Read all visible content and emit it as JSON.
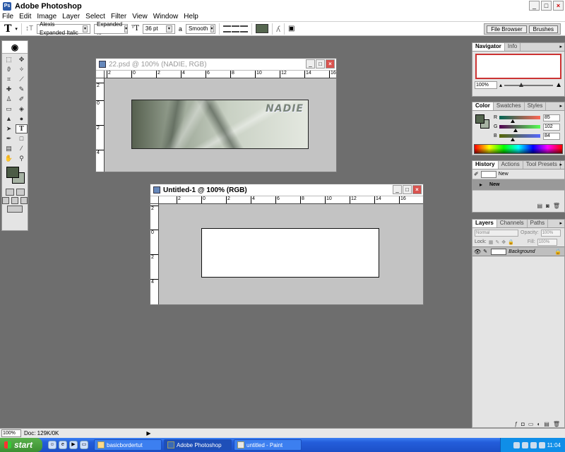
{
  "app": {
    "title": "Adobe Photoshop",
    "logo": "Ps"
  },
  "window_controls": {
    "minimize": "_",
    "maximize": "□",
    "close": "×"
  },
  "menu": [
    "File",
    "Edit",
    "Image",
    "Layer",
    "Select",
    "Filter",
    "View",
    "Window",
    "Help"
  ],
  "options": {
    "tool_glyph": "T",
    "font_family": "Alexis Expanded Italic",
    "font_style": "Expanded ...",
    "font_size": "36 pt",
    "aa_label": "a",
    "antialias": "Smooth",
    "text_color": "#55664f"
  },
  "palette_well": {
    "tabs": [
      "File Browser",
      "Brushes"
    ]
  },
  "toolbox": {
    "colors": {
      "foreground": "#4c5c46",
      "background": "#a6b2a3"
    }
  },
  "documents": {
    "doc1": {
      "title": "22.psd @ 100% (NADIE, RGB)",
      "ruler_h": [
        "2",
        "0",
        "2",
        "4",
        "6",
        "8",
        "10",
        "12",
        "14",
        "16"
      ],
      "ruler_v": [
        "2",
        "0",
        "2",
        "4"
      ],
      "wordmark": "NADIE"
    },
    "doc2": {
      "title": "Untitled-1 @ 100% (RGB)",
      "ruler_h": [
        "2",
        "0",
        "2",
        "4",
        "6",
        "8",
        "10",
        "12",
        "14",
        "16"
      ],
      "ruler_v": [
        "2",
        "0",
        "2",
        "4"
      ]
    }
  },
  "navigator": {
    "tabs": [
      "Navigator",
      "Info"
    ],
    "zoom": "100%"
  },
  "color_palette": {
    "tabs": [
      "Color",
      "Swatches",
      "Styles"
    ],
    "R": "85",
    "G": "102",
    "B": "84",
    "r_level": 0.33,
    "g_level": 0.4,
    "b_level": 0.33
  },
  "history": {
    "tabs": [
      "History",
      "Actions",
      "Tool Presets"
    ],
    "items": [
      {
        "label": "New"
      },
      {
        "label": "New"
      }
    ]
  },
  "layers": {
    "tabs": [
      "Layers",
      "Channels",
      "Paths"
    ],
    "blend_mode": "Normal",
    "opacity_label": "Opacity:",
    "opacity": "100%",
    "lock_label": "Lock:",
    "fill_label": "Fill:",
    "fill": "100%",
    "layer_name": "Background"
  },
  "status": {
    "zoom": "100%",
    "doc_info": "Doc: 129K/0K"
  },
  "taskbar": {
    "start": "start",
    "buttons": [
      "basicbordertut",
      "Adobe Photoshop",
      "untitled - Paint"
    ],
    "clock": "11:04"
  }
}
